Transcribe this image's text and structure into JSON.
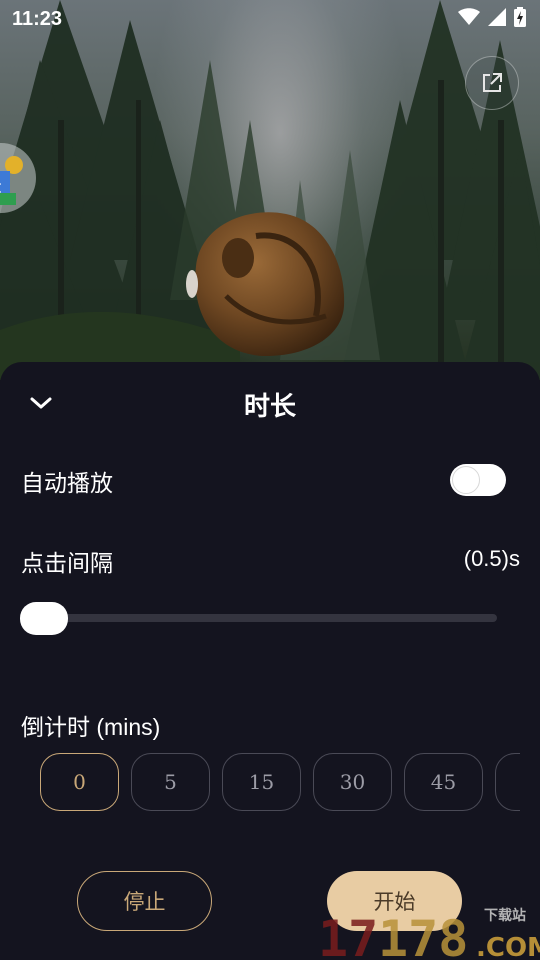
{
  "status_bar": {
    "time": "11:23",
    "icons": [
      "wifi-icon",
      "signal-icon",
      "battery-charging-icon"
    ]
  },
  "overlay": {
    "share_icon": "external-link-icon",
    "floating_app_icon": "photos-icon"
  },
  "sheet": {
    "title": "时长",
    "collapse_icon": "chevron-down-icon",
    "autoplay": {
      "label": "自动播放",
      "enabled": false
    },
    "click_interval": {
      "label": "点击间隔",
      "value_text": "(0.5)s",
      "slider_fraction": 0.0
    },
    "countdown": {
      "label": "倒计时 (mins)",
      "options": [
        "0",
        "5",
        "15",
        "30",
        "45",
        ""
      ],
      "selected_index": 0
    },
    "stop_label": "停止",
    "start_label": "开始"
  },
  "watermark": {
    "brand": "17178",
    "suffix": ".COM",
    "tag": "下载站"
  },
  "colors": {
    "sheet_bg": "#14141f",
    "accent_gold": "#c9a878",
    "start_fill": "#e8cca3",
    "chip_border": "#4a4a56"
  }
}
